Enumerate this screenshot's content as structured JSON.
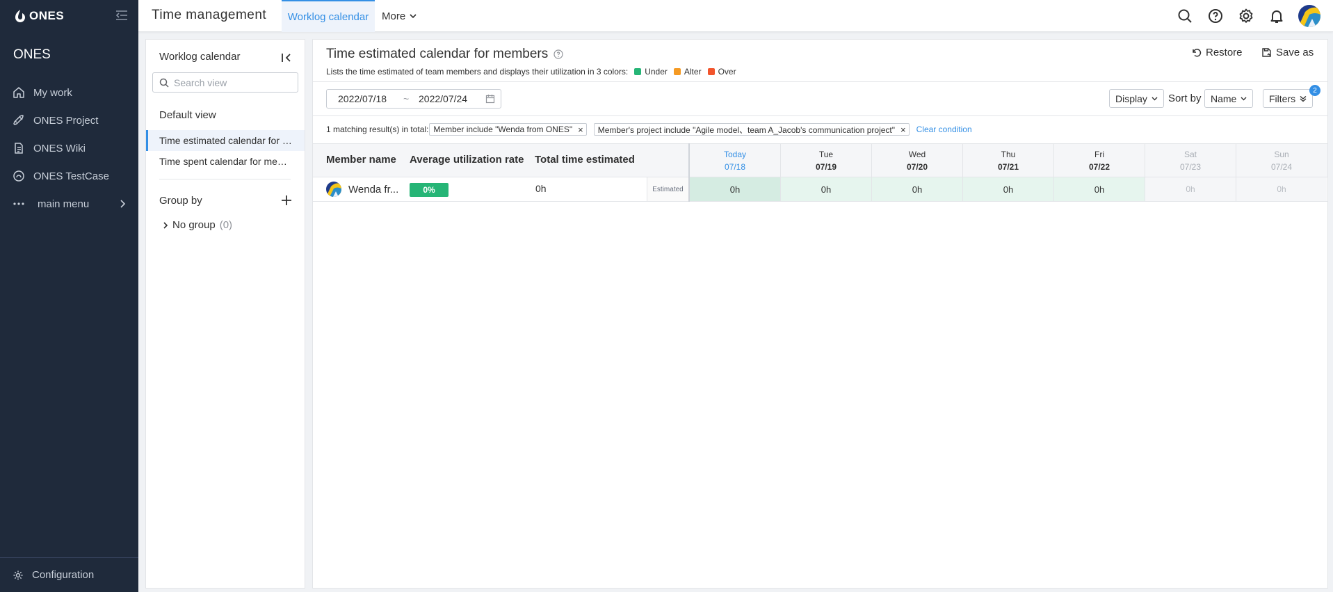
{
  "brand": {
    "logo_text": "ONES",
    "org_name": "ONES"
  },
  "sidebar": {
    "items": [
      {
        "label": "My work",
        "icon": "home-icon"
      },
      {
        "label": "ONES Project",
        "icon": "rocket-icon"
      },
      {
        "label": "ONES Wiki",
        "icon": "document-icon"
      },
      {
        "label": "ONES TestCase",
        "icon": "testcase-icon"
      },
      {
        "label": "main menu",
        "icon": "ellipsis-icon"
      }
    ],
    "configuration": "Configuration"
  },
  "header": {
    "title": "Time management",
    "active_tab": "Worklog calendar",
    "more_tab": "More"
  },
  "views_panel": {
    "title": "Worklog calendar",
    "search_placeholder": "Search view",
    "default_view": "Default view",
    "views": [
      "Time estimated calendar for members",
      "Time spent calendar for members"
    ],
    "group_by": "Group by",
    "no_group_label": "No group",
    "no_group_count": "(0)"
  },
  "main": {
    "title": "Time estimated calendar for members",
    "description": "Lists the time estimated of team members and displays their utilization in 3 colors:",
    "legend": [
      {
        "label": "Under",
        "color": "#26b576"
      },
      {
        "label": "Alter",
        "color": "#f59a23"
      },
      {
        "label": "Over",
        "color": "#f2552c"
      }
    ],
    "restore_label": "Restore",
    "saveas_label": "Save as",
    "date_from": "2022/07/18",
    "date_sep": "~",
    "date_to": "2022/07/24",
    "display_label": "Display",
    "sortby_label": "Sort by",
    "sortby_value": "Name",
    "filters_label": "Filters",
    "filters_count": "2",
    "result_text": "1 matching result(s) in total:",
    "filter_tags": [
      "Member include \"Wenda from ONES\"",
      "Member's project include \"Agile model、team A_Jacob's communication project\""
    ],
    "clear_condition": "Clear condition"
  },
  "table": {
    "columns": [
      "Member name",
      "Average utilization rate",
      "Total time estimated"
    ],
    "days": [
      {
        "day": "Today",
        "date": "07/18"
      },
      {
        "day": "Tue",
        "date": "07/19"
      },
      {
        "day": "Wed",
        "date": "07/20"
      },
      {
        "day": "Thu",
        "date": "07/21"
      },
      {
        "day": "Fri",
        "date": "07/22"
      },
      {
        "day": "Sat",
        "date": "07/23"
      },
      {
        "day": "Sun",
        "date": "07/24"
      }
    ],
    "rows": [
      {
        "member": "Wenda from ONES",
        "member_display": "Wenda fr...",
        "utilization": "0%",
        "total": "0h",
        "row_label": "Estimated",
        "day_values": [
          "0h",
          "0h",
          "0h",
          "0h",
          "0h",
          "0h",
          "0h"
        ]
      }
    ]
  }
}
